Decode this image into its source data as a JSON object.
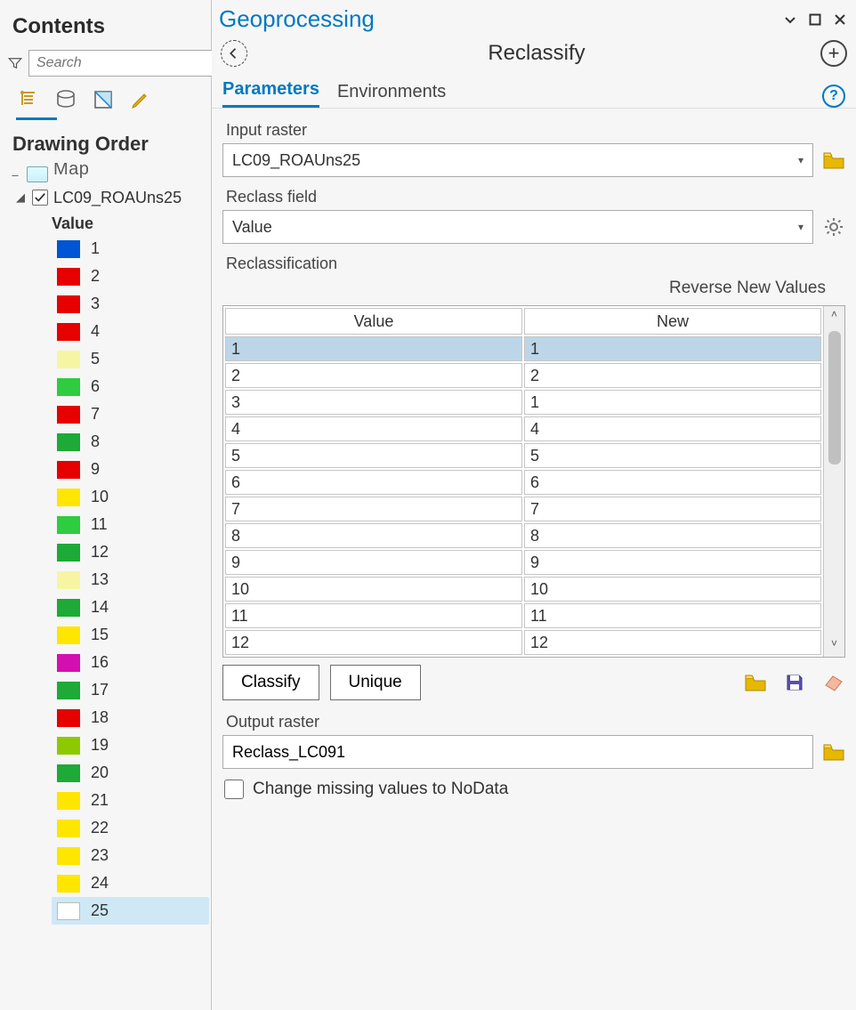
{
  "contents": {
    "title": "Contents",
    "search_placeholder": "Search",
    "drawing_order_label": "Drawing Order",
    "map_label": "Map",
    "layer": {
      "checked": true,
      "name": "LC09_ROAUns25",
      "value_heading": "Value",
      "selected_index": 24,
      "legend": [
        {
          "label": "1",
          "color": "#0055d4"
        },
        {
          "label": "2",
          "color": "#e60000"
        },
        {
          "label": "3",
          "color": "#e60000"
        },
        {
          "label": "4",
          "color": "#e60000"
        },
        {
          "label": "5",
          "color": "#f6f5a3"
        },
        {
          "label": "6",
          "color": "#2ecc40"
        },
        {
          "label": "7",
          "color": "#e60000"
        },
        {
          "label": "8",
          "color": "#1eaa36"
        },
        {
          "label": "9",
          "color": "#e60000"
        },
        {
          "label": "10",
          "color": "#ffe600"
        },
        {
          "label": "11",
          "color": "#2ecc40"
        },
        {
          "label": "12",
          "color": "#1eaa36"
        },
        {
          "label": "13",
          "color": "#f6f5a3"
        },
        {
          "label": "14",
          "color": "#1eaa36"
        },
        {
          "label": "15",
          "color": "#ffe600"
        },
        {
          "label": "16",
          "color": "#d40fb0"
        },
        {
          "label": "17",
          "color": "#1eaa36"
        },
        {
          "label": "18",
          "color": "#e60000"
        },
        {
          "label": "19",
          "color": "#8ec900"
        },
        {
          "label": "20",
          "color": "#1eaa36"
        },
        {
          "label": "21",
          "color": "#ffe600"
        },
        {
          "label": "22",
          "color": "#ffe600"
        },
        {
          "label": "23",
          "color": "#ffe600"
        },
        {
          "label": "24",
          "color": "#ffe600"
        },
        {
          "label": "25",
          "color": ""
        }
      ]
    }
  },
  "gp": {
    "pane_title": "Geoprocessing",
    "tool_name": "Reclassify",
    "tabs": {
      "parameters": "Parameters",
      "environments": "Environments",
      "active": "parameters"
    },
    "input_raster_label": "Input raster",
    "input_raster_value": "LC09_ROAUns25",
    "reclass_field_label": "Reclass field",
    "reclass_field_value": "Value",
    "reclassification_label": "Reclassification",
    "reverse_label": "Reverse New Values",
    "table": {
      "headers": {
        "value": "Value",
        "new": "New"
      },
      "selected_row": 0,
      "rows": [
        {
          "value": "1",
          "new": "1"
        },
        {
          "value": "2",
          "new": "2"
        },
        {
          "value": "3",
          "new": "1"
        },
        {
          "value": "4",
          "new": "4"
        },
        {
          "value": "5",
          "new": "5"
        },
        {
          "value": "6",
          "new": "6"
        },
        {
          "value": "7",
          "new": "7"
        },
        {
          "value": "8",
          "new": "8"
        },
        {
          "value": "9",
          "new": "9"
        },
        {
          "value": "10",
          "new": "10"
        },
        {
          "value": "11",
          "new": "11"
        },
        {
          "value": "12",
          "new": "12"
        }
      ]
    },
    "buttons": {
      "classify": "Classify",
      "unique": "Unique"
    },
    "output_raster_label": "Output raster",
    "output_raster_value": "Reclass_LC091",
    "nodata_label": "Change missing values to NoData",
    "nodata_checked": false
  }
}
